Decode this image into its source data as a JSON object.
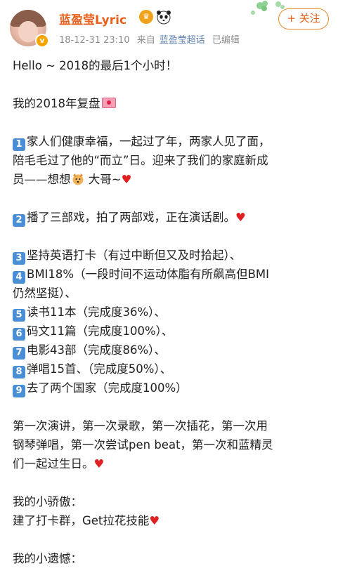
{
  "post": {
    "username": "蓝盈莹Lyric",
    "timestamp": "18-12-31 23:10",
    "source_prefix": "来自",
    "source_name": "蓝盈莹超话",
    "edited": "已编辑",
    "follow_label": "+ 关注",
    "verified_icon": "v",
    "crown_icon": "crown-icon",
    "panda_icon": "panda-icon"
  },
  "colors": {
    "username": "#e8601c",
    "follow_border": "#e68a2e",
    "number_badge": "#4a8fd6",
    "heart": "#e02020"
  },
  "content": {
    "l1": "Hello ~ 2018的最后1个小时！",
    "l2": "我的2018年复盘",
    "i1_num": "1",
    "i1a": "家人们健康幸福，一起过了年，两家人见了面，",
    "i1b": "陪毛毛过了他的“而立”日。迎来了我们的家庭新成",
    "i1c_pre": "员——想想",
    "i1c_post": " 大哥~",
    "i2_num": "2",
    "i2": "播了三部戏，拍了两部戏，正在演话剧。",
    "i3_num": "3",
    "i3": "坚持英语打卡（有过中断但又及时拾起）、",
    "i4_num": "4",
    "i4a": "BMI18%（一段时间不运动体脂有所飙高但BMI",
    "i4b": "仍然坚挺）、",
    "i5_num": "5",
    "i5": "读书11本（完成度36%）、",
    "i6_num": "6",
    "i6": "码文11篇（完成度100%）、",
    "i7_num": "7",
    "i7": "电影43部（完成度86%）、",
    "i8_num": "8",
    "i8": "弹唱15首、（完成度50%）、",
    "i9_num": "9",
    "i9": "去了两个国家（完成度100%）",
    "p1a": "第一次演讲，第一次录歌，第一次插花，第一次用",
    "p1b": "钢琴弹唱，第一次尝试pen beat，第一次和蓝精灵",
    "p1c": "们一起过生日。",
    "pride_title": "我的小骄傲：",
    "pride_text": "建了打卡群，Get拉花技能",
    "regret_title": "我的小遗憾：",
    "heart": "♥"
  }
}
